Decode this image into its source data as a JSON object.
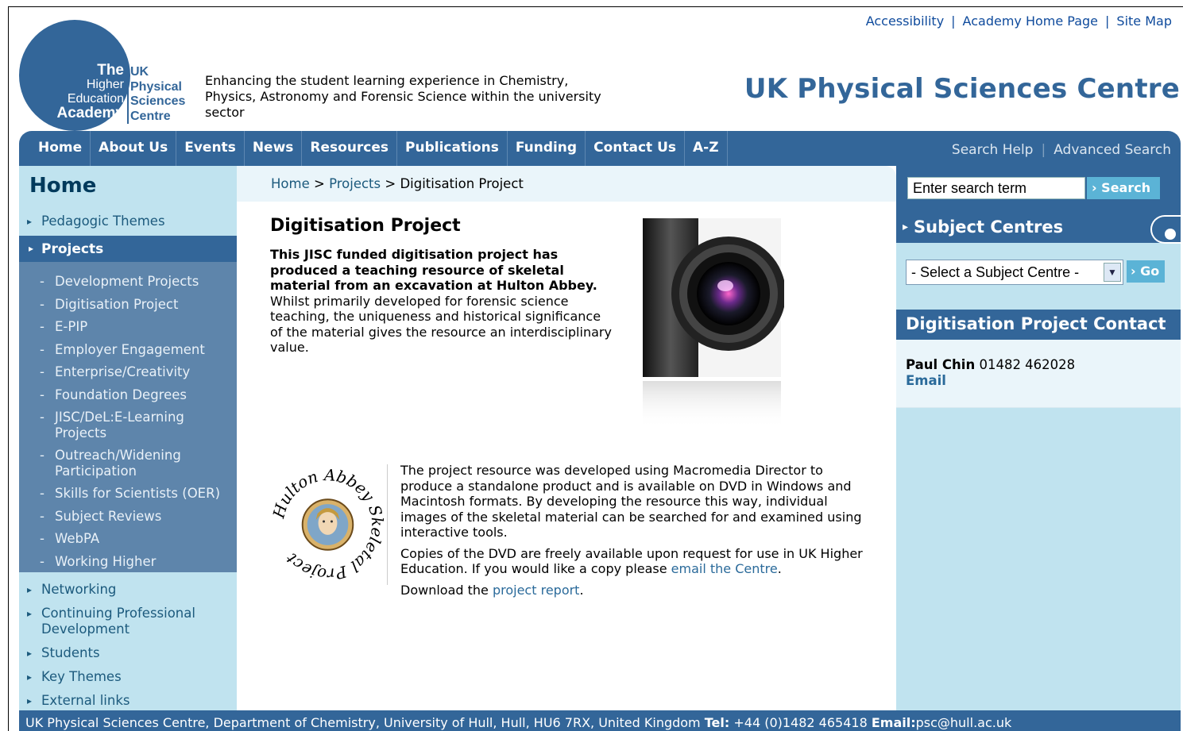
{
  "top_links": [
    "Accessibility",
    "Academy Home Page",
    "Site Map"
  ],
  "logo": {
    "left_lines": [
      "The",
      "Higher",
      "Education",
      "Academy"
    ],
    "right_lines": [
      "UK",
      "Physical",
      "Sciences",
      "Centre"
    ]
  },
  "tagline": "Enhancing the student learning experience in Chemistry, Physics, Astronomy and Forensic Science within the university sector",
  "site_title": "UK Physical Sciences Centre",
  "nav": {
    "items": [
      "Home",
      "About Us",
      "Events",
      "News",
      "Resources",
      "Publications",
      "Funding",
      "Contact Us",
      "A-Z"
    ],
    "search_help": "Search Help",
    "advanced_search": "Advanced Search"
  },
  "sidebar": {
    "title": "Home",
    "top_items": [
      "Pedagogic Themes"
    ],
    "active": "Projects",
    "sub_items": [
      "Development Projects",
      "Digitisation Project",
      "E-PIP",
      "Employer Engagement",
      "Enterprise/Creativity",
      "Foundation Degrees",
      "JISC/DeL:E-Learning Projects",
      "Outreach/Widening Participation",
      "Skills for Scientists (OER)",
      "Subject Reviews",
      "WebPA",
      "Working Higher"
    ],
    "bottom_items": [
      "Networking",
      "Continuing Professional Development",
      "Students",
      "Key Themes",
      "External links"
    ]
  },
  "breadcrumb": {
    "home": "Home",
    "sep": ">",
    "projects": "Projects",
    "current": "Digitisation Project"
  },
  "main": {
    "title": "Digitisation Project",
    "intro_bold": "This JISC funded digitisation project has produced a teaching resource of skeletal material from an excavation at Hulton Abbey.",
    "intro_rest": " Whilst primarily developed for forensic science teaching, the uniqueness and historical significance of the material gives the resource an interdisciplinary value.",
    "seal_text": "Hulton Abbey Skeletal Project",
    "para1": "The project resource was developed using Macromedia Director to produce a standalone product and is available on DVD in Windows and Macintosh formats. By developing the resource this way, individual images of the skeletal material can be searched for and examined using interactive tools.",
    "para2_pre": "Copies of the DVD are freely available upon request for use in UK Higher Education. If you would like a copy please ",
    "para2_link": "email the Centre",
    "para2_post": ".",
    "para3_pre": "Download the ",
    "para3_link": "project report",
    "para3_post": "."
  },
  "right": {
    "search_placeholder": "Enter search term",
    "search_button": "Search",
    "subject_centres_title": "Subject Centres",
    "select_value": "- Select a Subject Centre -",
    "go_button": "Go",
    "contact_title": "Digitisation Project Contact",
    "contact_name": "Paul Chin",
    "contact_phone": "01482 462028",
    "contact_email": "Email"
  },
  "footer": {
    "address": "UK Physical Sciences Centre, Department of Chemistry, University of Hull, Hull, HU6 7RX, United Kingdom ",
    "tel_label": "Tel:",
    "tel": " +44 (0)1482 465418 ",
    "email_label": "Email:",
    "email": "psc@hull.ac.uk"
  },
  "colors": {
    "brand": "#336699",
    "sidebar_bg": "#c0e3ef",
    "submenu_bg": "#5e85ab",
    "button": "#5bb3d6"
  }
}
